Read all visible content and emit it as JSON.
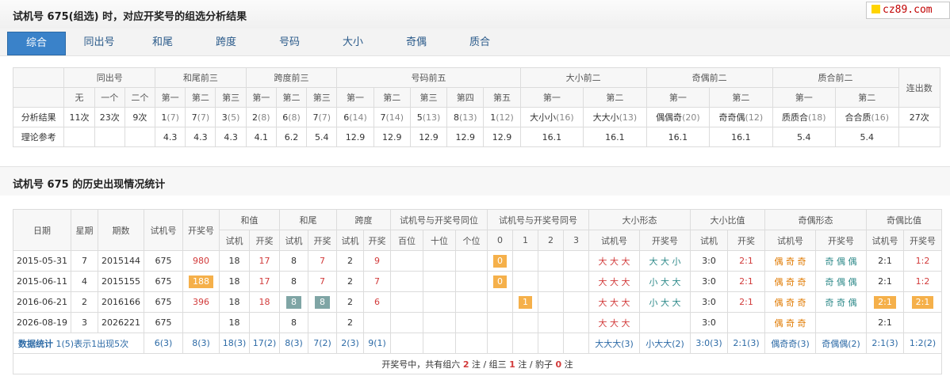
{
  "title": "试机号 675(组选) 时，对应开奖号的组选分析结果",
  "logo_text": "cz89.com",
  "tabs": [
    "综合",
    "同出号",
    "和尾",
    "跨度",
    "号码",
    "大小",
    "奇偶",
    "质合"
  ],
  "active_tab": "综合",
  "analysis": {
    "groups": [
      "同出号",
      "和尾前三",
      "跨度前三",
      "号码前五",
      "大小前二",
      "奇偶前二",
      "质合前二",
      "连出数"
    ],
    "sub_headers": [
      "无",
      "一个",
      "二个",
      "第一",
      "第二",
      "第三",
      "第一",
      "第二",
      "第三",
      "第一",
      "第二",
      "第三",
      "第四",
      "第五",
      "第一",
      "第二",
      "第一",
      "第二",
      "第一",
      "第二"
    ],
    "result_label": "分析结果",
    "result": [
      {
        "v": "11次"
      },
      {
        "v": "23次"
      },
      {
        "v": "9次"
      },
      {
        "v": "1",
        "g": "(7)"
      },
      {
        "v": "7",
        "g": "(7)"
      },
      {
        "v": "3",
        "g": "(5)"
      },
      {
        "v": "2",
        "g": "(8)"
      },
      {
        "v": "6",
        "g": "(8)"
      },
      {
        "v": "7",
        "g": "(7)"
      },
      {
        "v": "6",
        "g": "(14)"
      },
      {
        "v": "7",
        "g": "(14)"
      },
      {
        "v": "5",
        "g": "(13)"
      },
      {
        "v": "8",
        "g": "(13)"
      },
      {
        "v": "1",
        "g": "(12)"
      },
      {
        "v": "大小小",
        "g": "(16)"
      },
      {
        "v": "大大小",
        "g": "(13)"
      },
      {
        "v": "偶偶奇",
        "g": "(20)"
      },
      {
        "v": "奇奇偶",
        "g": "(12)"
      },
      {
        "v": "质质合",
        "g": "(18)"
      },
      {
        "v": "合合质",
        "g": "(16)"
      },
      {
        "v": "27次"
      }
    ],
    "theory_label": "理论参考",
    "theory": [
      "",
      "",
      "",
      "4.3",
      "4.3",
      "4.3",
      "4.1",
      "6.2",
      "5.4",
      "12.9",
      "12.9",
      "12.9",
      "12.9",
      "12.9",
      "16.1",
      "16.1",
      "16.1",
      "16.1",
      "5.4",
      "5.4",
      ""
    ]
  },
  "history_title": "试机号 675 的历史出现情况统计",
  "history": {
    "headers": {
      "date": "日期",
      "weekday": "星期",
      "issue": "期数",
      "trial": "试机号",
      "draw": "开奖号",
      "sum": "和值",
      "tail": "和尾",
      "span": "跨度",
      "same_pos": "试机号与开奖号同位",
      "same_num": "试机号与开奖号同号",
      "size_form": "大小形态",
      "size_ratio": "大小比值",
      "parity_form": "奇偶形态",
      "parity_ratio": "奇偶比值"
    },
    "sub": {
      "trial": "试机",
      "draw": "开奖",
      "trial_no": "试机号",
      "draw_no": "开奖号",
      "hundreds": "百位",
      "tens": "十位",
      "units": "个位",
      "n0": "0",
      "n1": "1",
      "n2": "2",
      "n3": "3"
    },
    "rows": [
      {
        "date": "2015-05-31",
        "wd": "7",
        "issue": "2015144",
        "trial": "675",
        "draw": "980",
        "sum_t": "18",
        "sum_d": "17",
        "tail_t": "8",
        "tail_d": "7",
        "span_t": "2",
        "span_d": "9",
        "same": "0",
        "same_col": 0,
        "sz_t": "大 大 大",
        "sz_d": "大 大 小",
        "sr_t": "3:0",
        "sr_d": "2:1",
        "pf_t": "偶 奇 奇",
        "pf_d": "奇 偶 偶",
        "pr_t": "2:1",
        "pr_d": "1:2"
      },
      {
        "date": "2015-06-11",
        "wd": "4",
        "issue": "2015155",
        "trial": "675",
        "draw": "188",
        "sum_t": "18",
        "sum_d": "17",
        "tail_t": "8",
        "tail_d": "7",
        "span_t": "2",
        "span_d": "7",
        "same": "0",
        "same_col": 0,
        "sz_t": "大 大 大",
        "sz_d": "小 大 大",
        "sr_t": "3:0",
        "sr_d": "2:1",
        "pf_t": "偶 奇 奇",
        "pf_d": "奇 偶 偶",
        "pr_t": "2:1",
        "pr_d": "1:2"
      },
      {
        "date": "2016-06-21",
        "wd": "2",
        "issue": "2016166",
        "trial": "675",
        "draw": "396",
        "sum_t": "18",
        "sum_d": "18",
        "tail_t": "8",
        "tail_d": "8",
        "span_t": "2",
        "span_d": "6",
        "same": "1",
        "same_col": 1,
        "sz_t": "大 大 大",
        "sz_d": "小 大 大",
        "sr_t": "3:0",
        "sr_d": "2:1",
        "pf_t": "偶 奇 奇",
        "pf_d": "奇 奇 偶",
        "pr_t": "2:1",
        "pr_d": "2:1"
      },
      {
        "date": "2026-08-19",
        "wd": "3",
        "issue": "2026221",
        "trial": "675",
        "draw": "",
        "sum_t": "18",
        "sum_d": "",
        "tail_t": "8",
        "tail_d": "",
        "span_t": "2",
        "span_d": "",
        "same": "",
        "same_col": -1,
        "sz_t": "大 大 大",
        "sz_d": "",
        "sr_t": "3:0",
        "sr_d": "",
        "pf_t": "偶 奇 奇",
        "pf_d": "",
        "pr_t": "2:1",
        "pr_d": ""
      }
    ],
    "stats": {
      "label": "数据统计",
      "note": "1(5)表示1出现5次",
      "trial": "6(3)",
      "draw": "8(3)",
      "sum_t": "18(3)",
      "sum_d": "17(2)",
      "tail_t": "8(3)",
      "tail_d": "7(2)",
      "span_t": "2(3)",
      "span_d": "9(1)",
      "sz_t": "大大大(3)",
      "sz_d": "小大大(2)",
      "sr_t": "3:0(3)",
      "sr_d": "2:1(3)",
      "pf_t": "偶奇奇(3)",
      "pf_d": "奇偶偶(2)",
      "pr_t": "2:1(3)",
      "pr_d": "1:2(2)"
    },
    "summary": {
      "prefix": "开奖号中，共有组六 ",
      "g6": "2",
      "mid1": " 注 / 组三 ",
      "g3": "1",
      "mid2": " 注 / 豹子 ",
      "bz": "0",
      "suffix": " 注"
    }
  }
}
